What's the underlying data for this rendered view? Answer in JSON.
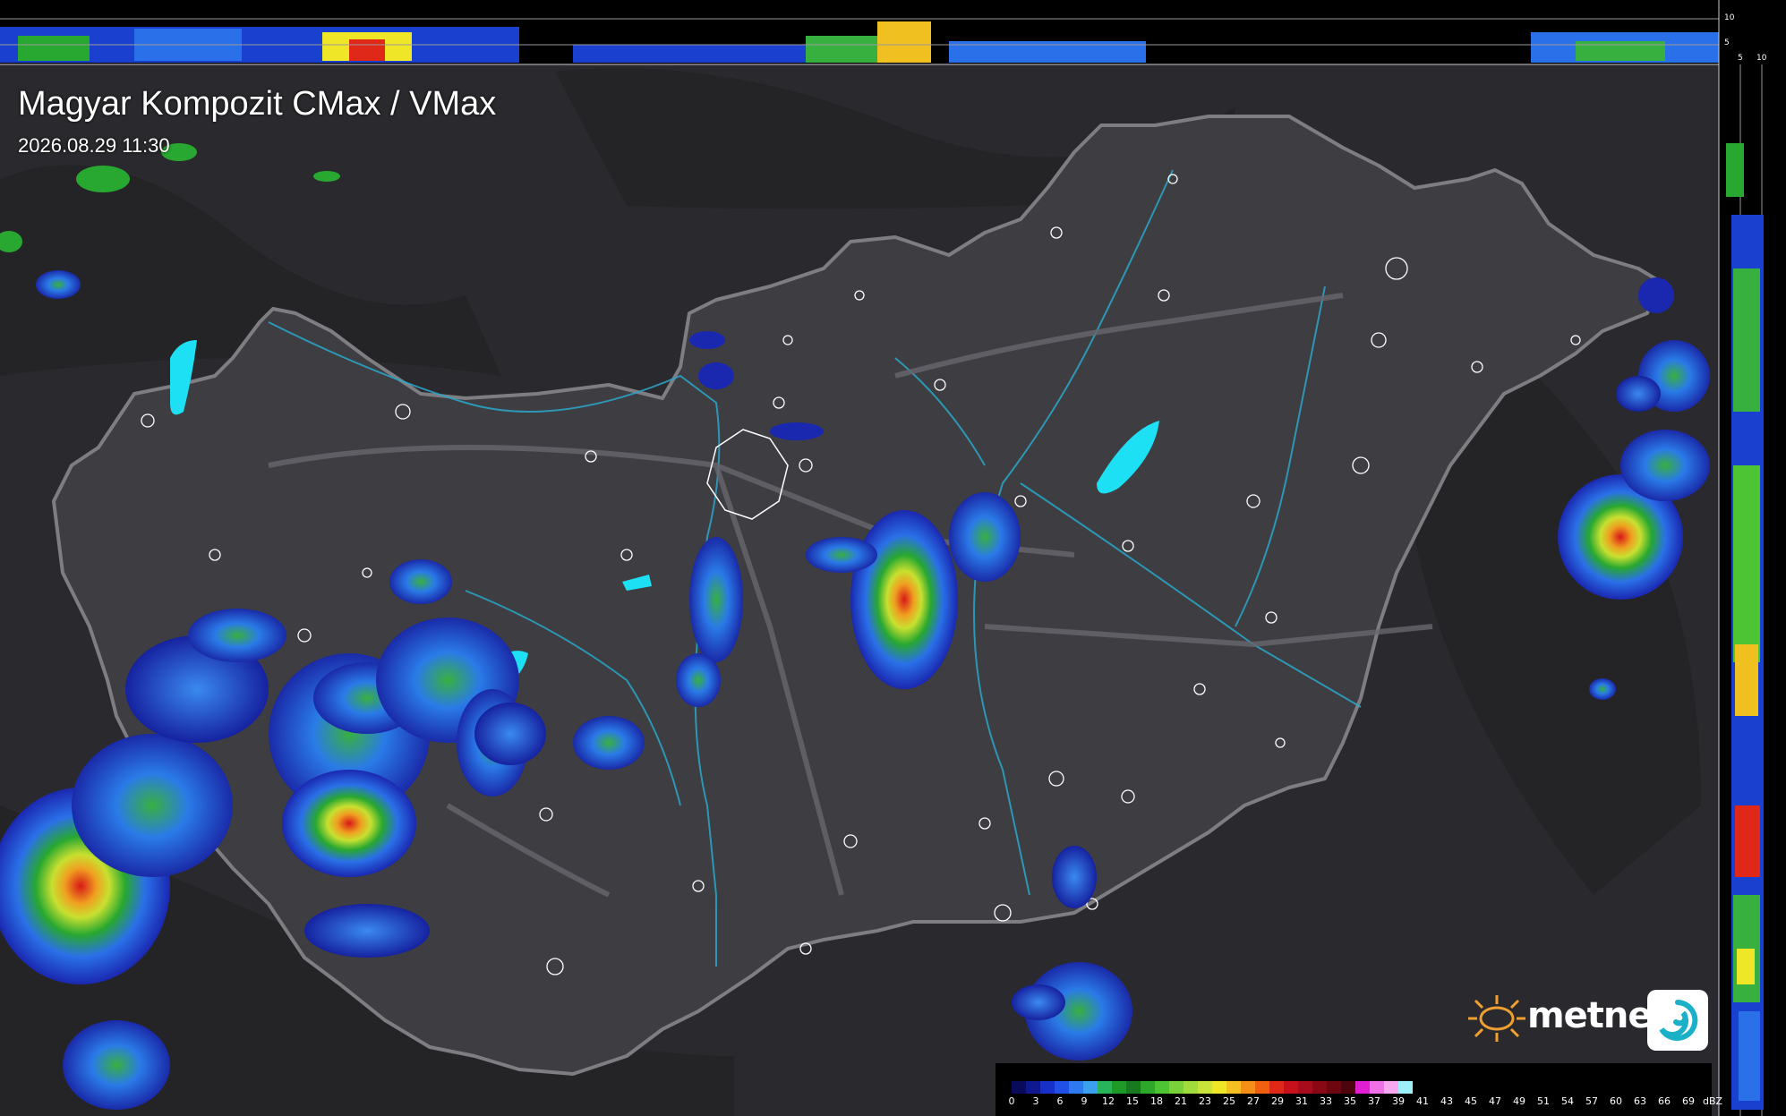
{
  "map": {
    "title": "Magyar Kompozit CMax / VMax",
    "timestamp": "2026.08.29 11:30",
    "background_color": "#2a2a2e",
    "country_fill": "#3d3d42",
    "country_border_color": "#7d7d82",
    "river_color": "#2aa7c9",
    "lake_color": "#1de0f5",
    "settlement_outline_color": "#ffffff"
  },
  "cross_section": {
    "top_strip_tick_labels": [
      "10",
      "5"
    ],
    "side_strip_tick_labels": [
      "5",
      "10"
    ]
  },
  "brand": {
    "name": "metnet",
    "logo_icon": "sun-icon",
    "app_icon": "swirl-icon"
  },
  "legend": {
    "unit": "dBZ",
    "labels": [
      "0",
      "3",
      "6",
      "9",
      "12",
      "15",
      "18",
      "21",
      "23",
      "25",
      "27",
      "29",
      "31",
      "33",
      "35",
      "37",
      "39",
      "41",
      "43",
      "45",
      "47",
      "49",
      "51",
      "54",
      "57",
      "60",
      "63",
      "66",
      "69"
    ],
    "colors": [
      "#0a0a5a",
      "#101890",
      "#1830c8",
      "#2050e8",
      "#2e78f0",
      "#3ca0f0",
      "#28b45a",
      "#1e9a28",
      "#187a1e",
      "#2ea82a",
      "#4cc434",
      "#7ad23a",
      "#a0dc3c",
      "#c8e43a",
      "#f0e628",
      "#f4c020",
      "#f49018",
      "#f06010",
      "#e02818",
      "#c8101a",
      "#a80c1a",
      "#8a0814",
      "#6e0610",
      "#4e040c",
      "#e020d0",
      "#f070e8",
      "#f8a8f0",
      "#9ef0f8"
    ]
  }
}
